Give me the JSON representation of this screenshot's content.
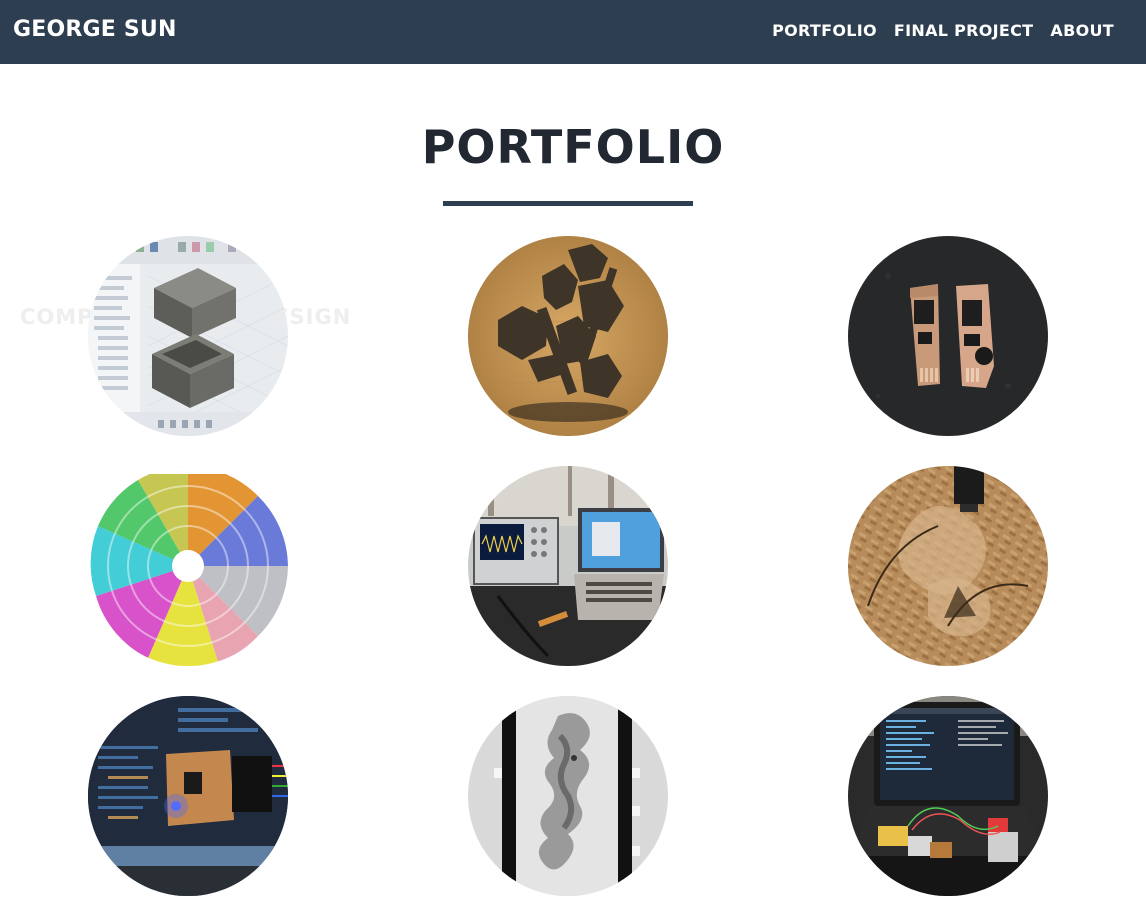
{
  "nav": {
    "brand": "GEORGE SUN",
    "links": [
      {
        "label": "PORTFOLIO"
      },
      {
        "label": "FINAL PROJECT"
      },
      {
        "label": "ABOUT"
      }
    ]
  },
  "main": {
    "title": "PORTFOLIO",
    "ghost_caption": "COMPUTER-AIDED DESIGN"
  },
  "colors": {
    "navbar": "#2c3e50",
    "title": "#222831",
    "divider": "#2c3e50"
  },
  "portfolio_items": [
    {
      "icon": "cad-enclosure-thumbnail"
    },
    {
      "icon": "cardboard-press-fit-thumbnail"
    },
    {
      "icon": "usb-pcb-boards-thumbnail"
    },
    {
      "icon": "protein-model-thumbnail"
    },
    {
      "icon": "oscilloscope-bench-thumbnail"
    },
    {
      "icon": "cnc-milled-osb-thumbnail"
    },
    {
      "icon": "pcb-blue-led-thumbnail"
    },
    {
      "icon": "xray-molded-part-thumbnail"
    },
    {
      "icon": "laptop-stepper-motor-thumbnail"
    }
  ]
}
